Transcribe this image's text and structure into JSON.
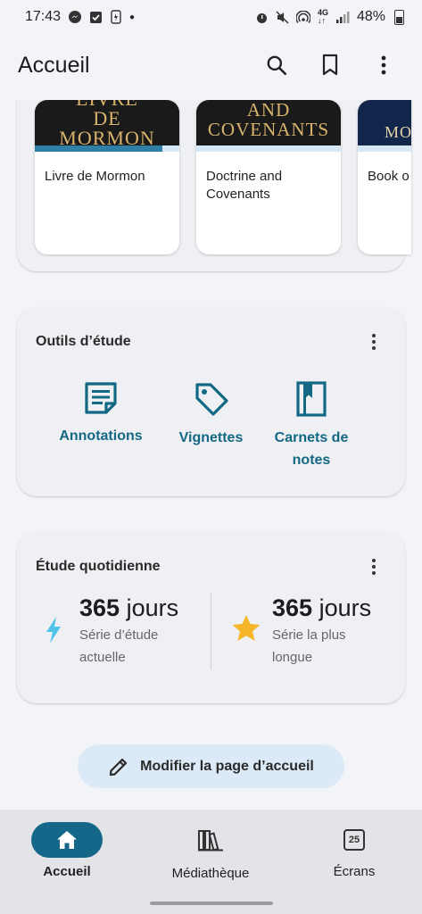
{
  "status_bar": {
    "time": "17:43",
    "left_icons": [
      "messenger-icon",
      "check-icon",
      "usb-icon",
      "dot-icon"
    ],
    "right_icons": [
      "alarm-icon",
      "mute-icon",
      "hotspot-icon",
      "4g-icon",
      "signal-icon"
    ],
    "battery": "48%"
  },
  "app_bar": {
    "title": "Accueil",
    "actions": [
      "search-icon",
      "bookmark-icon",
      "more-vert-icon"
    ]
  },
  "books": [
    {
      "cover": "LE\nLIVRE\nDE\nMORMON",
      "title": "Livre de Mormon",
      "progress": 0.88
    },
    {
      "cover": "AND\nCOVENANTS",
      "title": "Doctrine and Covenants",
      "progress": 0.0
    },
    {
      "cover": "MO",
      "title": "Book o",
      "progress": 0.0
    }
  ],
  "study_tools": {
    "title": "Outils d’étude",
    "items": [
      {
        "label": "Annotations",
        "icon": "annotations-icon"
      },
      {
        "label": "Vignettes",
        "icon": "tag-icon"
      },
      {
        "label": "Carnets de notes",
        "icon": "notebook-icon"
      }
    ]
  },
  "daily_study": {
    "title": "Étude quotidienne",
    "current_streak": {
      "number": "365",
      "unit": "jours",
      "label": "Série d’étude actuelle"
    },
    "longest_streak": {
      "number": "365",
      "unit": "jours",
      "label": "Série la plus longue"
    }
  },
  "edit_button": {
    "label": "Modifier la page d’accueil"
  },
  "bottom_nav": {
    "items": [
      {
        "label": "Accueil",
        "icon": "home-icon",
        "active": true
      },
      {
        "label": "Médiathèque",
        "icon": "library-icon",
        "active": false
      },
      {
        "label": "Écrans",
        "icon": "calendar-icon",
        "badge": "25",
        "active": false
      }
    ]
  },
  "colors": {
    "accent": "#136884",
    "nav_active": "#15678a",
    "bolt": "#4fc3e8",
    "star": "#f5b62a",
    "edit_button_bg": "#dbeaf6"
  }
}
